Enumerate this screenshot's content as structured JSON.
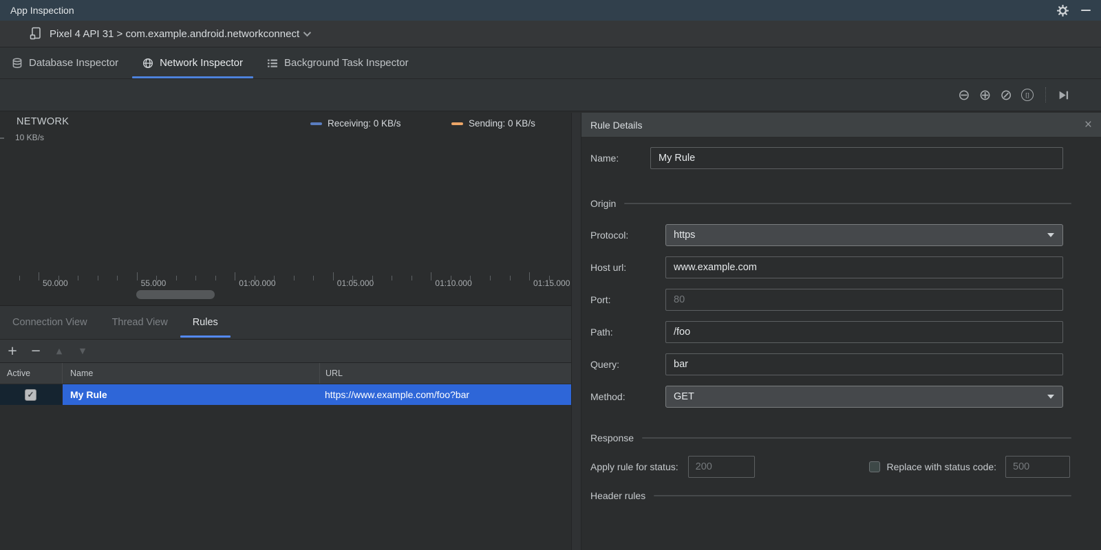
{
  "titlebar": {
    "title": "App Inspection"
  },
  "devicebar": {
    "selection": "Pixel 4 API 31 > com.example.android.networkconnect"
  },
  "inspector_tabs": {
    "database": "Database Inspector",
    "network": "Network Inspector",
    "background": "Background Task Inspector"
  },
  "chart": {
    "title": "NETWORK",
    "legend": {
      "receiving": "Receiving: 0 KB/s",
      "sending": "Sending: 0 KB/s"
    }
  },
  "chart_data": {
    "type": "line",
    "title": "NETWORK",
    "ylabel_tick": "10 KB/s",
    "ylim_kbps": [
      0,
      10
    ],
    "x_tick_labels": [
      "50.000",
      "55.000",
      "01:00.000",
      "01:05.000",
      "01:10.000",
      "01:15.000"
    ],
    "minor_ticks_per_major": 5,
    "grid": false,
    "legend_position": "top-right",
    "series": [
      {
        "name": "Receiving",
        "unit": "KB/s",
        "current_value": 0,
        "color": "#5a7dc0",
        "values": [
          0,
          0,
          0,
          0,
          0,
          0
        ]
      },
      {
        "name": "Sending",
        "unit": "KB/s",
        "current_value": 0,
        "color": "#eba567",
        "values": [
          0,
          0,
          0,
          0,
          0,
          0
        ]
      }
    ]
  },
  "view_tabs": {
    "connection": "Connection View",
    "thread": "Thread View",
    "rules": "Rules"
  },
  "rules_table": {
    "columns": {
      "active": "Active",
      "name": "Name",
      "url": "URL"
    },
    "row": {
      "active_checked": true,
      "check_glyph": "✓",
      "name": "My Rule",
      "url": "https://www.example.com/foo?bar"
    }
  },
  "rule_details": {
    "title": "Rule Details",
    "close_glyph": "×",
    "sections": {
      "origin": "Origin",
      "response": "Response",
      "header_rules": "Header rules"
    },
    "fields": {
      "name_label": "Name:",
      "name_value": "My Rule",
      "protocol_label": "Protocol:",
      "protocol_value": "https",
      "host_label": "Host url:",
      "host_value": "www.example.com",
      "port_label": "Port:",
      "port_placeholder": "80",
      "path_label": "Path:",
      "path_value": "/foo",
      "query_label": "Query:",
      "query_value": "bar",
      "method_label": "Method:",
      "method_value": "GET"
    },
    "response": {
      "apply_label": "Apply rule for status:",
      "apply_placeholder": "200",
      "replace_label": "Replace with status code:",
      "replace_placeholder": "500",
      "replace_checked": false
    }
  }
}
